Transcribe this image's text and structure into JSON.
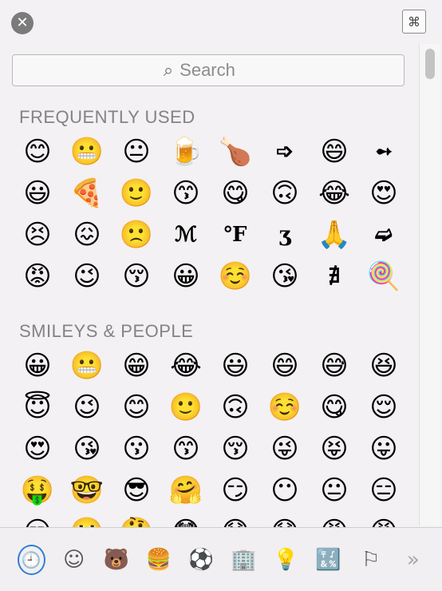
{
  "header": {
    "close_icon": "close-icon",
    "close_glyph": "✕",
    "grid_icon": "character-viewer-icon",
    "grid_glyph": "⌘"
  },
  "search": {
    "placeholder": "Search",
    "icon": "search-icon",
    "icon_glyph": "⌕"
  },
  "sections": [
    {
      "title": "FREQUENTLY USED",
      "items": [
        {
          "name": "smiling-face-with-smiling-eyes",
          "glyph": "😊"
        },
        {
          "name": "grimacing-face",
          "glyph": "😬"
        },
        {
          "name": "neutral-face",
          "glyph": "😐"
        },
        {
          "name": "beer-mug",
          "glyph": "🍺"
        },
        {
          "name": "poultry-leg",
          "glyph": "🍗"
        },
        {
          "name": "white-right-arrow",
          "glyph": "➩",
          "sym": true
        },
        {
          "name": "grinning-face-with-smiling-eyes",
          "glyph": "😄"
        },
        {
          "name": "feathered-arrow",
          "glyph": "➻",
          "sym": true
        },
        {
          "name": "smiley",
          "glyph": "😃"
        },
        {
          "name": "pizza",
          "glyph": "🍕"
        },
        {
          "name": "slightly-smiling-face",
          "glyph": "🙂"
        },
        {
          "name": "kissing-face-with-smiling-eyes",
          "glyph": "😙"
        },
        {
          "name": "face-savoring-food",
          "glyph": "😋"
        },
        {
          "name": "upside-down-face",
          "glyph": "🙃"
        },
        {
          "name": "face-with-tears-of-joy",
          "glyph": "😂"
        },
        {
          "name": "heart-eyes",
          "glyph": "😍"
        },
        {
          "name": "persevering-face",
          "glyph": "😣"
        },
        {
          "name": "confounded-face",
          "glyph": "😖"
        },
        {
          "name": "slightly-frowning-face",
          "glyph": "🙁"
        },
        {
          "name": "script-m",
          "glyph": "ℳ",
          "sym": true
        },
        {
          "name": "degree-fahrenheit",
          "glyph": "℉",
          "sym": true
        },
        {
          "name": "ezh",
          "glyph": "ʒ",
          "sym": true
        },
        {
          "name": "folded-hands",
          "glyph": "🙏"
        },
        {
          "name": "shadowed-arrow",
          "glyph": "➫",
          "sym": true
        },
        {
          "name": "pouting-face",
          "glyph": "😡"
        },
        {
          "name": "winking-face",
          "glyph": "😉"
        },
        {
          "name": "kissing-face-with-closed-eyes",
          "glyph": "😚"
        },
        {
          "name": "grinning-face",
          "glyph": "😀"
        },
        {
          "name": "smiling-face",
          "glyph": "☺️"
        },
        {
          "name": "face-blowing-a-kiss",
          "glyph": "😘"
        },
        {
          "name": "not-exists",
          "glyph": "∄",
          "sym": true
        },
        {
          "name": "lollipop",
          "glyph": "🍭"
        }
      ]
    },
    {
      "title": "SMILEYS & PEOPLE",
      "items": [
        {
          "name": "grinning-face",
          "glyph": "😀"
        },
        {
          "name": "grimacing-face",
          "glyph": "😬"
        },
        {
          "name": "beaming-face",
          "glyph": "😁"
        },
        {
          "name": "face-with-tears-of-joy",
          "glyph": "😂"
        },
        {
          "name": "smiley",
          "glyph": "😃"
        },
        {
          "name": "grinning-face-with-smiling-eyes",
          "glyph": "😄"
        },
        {
          "name": "grinning-face-with-sweat",
          "glyph": "😅"
        },
        {
          "name": "grinning-squinting-face",
          "glyph": "😆"
        },
        {
          "name": "smiling-face-with-halo",
          "glyph": "😇"
        },
        {
          "name": "winking-face",
          "glyph": "😉"
        },
        {
          "name": "smiling-face-with-smiling-eyes",
          "glyph": "😊"
        },
        {
          "name": "slightly-smiling-face",
          "glyph": "🙂"
        },
        {
          "name": "upside-down-face",
          "glyph": "🙃"
        },
        {
          "name": "smiling-face",
          "glyph": "☺️"
        },
        {
          "name": "face-savoring-food",
          "glyph": "😋"
        },
        {
          "name": "relieved-face",
          "glyph": "😌"
        },
        {
          "name": "heart-eyes",
          "glyph": "😍"
        },
        {
          "name": "face-blowing-a-kiss",
          "glyph": "😘"
        },
        {
          "name": "kissing-face",
          "glyph": "😗"
        },
        {
          "name": "kissing-face-with-smiling-eyes",
          "glyph": "😙"
        },
        {
          "name": "kissing-face-with-closed-eyes",
          "glyph": "😚"
        },
        {
          "name": "winking-face-with-tongue",
          "glyph": "😜"
        },
        {
          "name": "squinting-face-with-tongue",
          "glyph": "😝"
        },
        {
          "name": "face-with-tongue",
          "glyph": "😛"
        },
        {
          "name": "money-mouth-face",
          "glyph": "🤑"
        },
        {
          "name": "nerd-face",
          "glyph": "🤓"
        },
        {
          "name": "smiling-face-with-sunglasses",
          "glyph": "😎"
        },
        {
          "name": "hugging-face",
          "glyph": "🤗"
        },
        {
          "name": "smirking-face",
          "glyph": "😏"
        },
        {
          "name": "face-without-mouth",
          "glyph": "😶"
        },
        {
          "name": "neutral-face",
          "glyph": "😐"
        },
        {
          "name": "expressionless-face",
          "glyph": "😑"
        },
        {
          "name": "unamused-face",
          "glyph": "😒"
        },
        {
          "name": "face-with-rolling-eyes",
          "glyph": "🙄"
        },
        {
          "name": "thinking-face",
          "glyph": "🤔"
        },
        {
          "name": "flushed-face",
          "glyph": "😳"
        },
        {
          "name": "disappointed-face",
          "glyph": "😞"
        },
        {
          "name": "worried-face",
          "glyph": "😟"
        },
        {
          "name": "angry-face",
          "glyph": "😠"
        },
        {
          "name": "pouting-face",
          "glyph": "😡"
        }
      ]
    }
  ],
  "categories": [
    {
      "name": "recent-icon",
      "glyph": "🕘",
      "active": true
    },
    {
      "name": "smileys-icon",
      "glyph": "☺"
    },
    {
      "name": "animals-icon",
      "glyph": "🐻"
    },
    {
      "name": "food-icon",
      "glyph": "🍔"
    },
    {
      "name": "activity-icon",
      "glyph": "⚽"
    },
    {
      "name": "travel-icon",
      "glyph": "🏢"
    },
    {
      "name": "objects-icon",
      "glyph": "💡"
    },
    {
      "name": "symbols-icon",
      "glyph": "🔣"
    },
    {
      "name": "flags-icon",
      "glyph": "⚐"
    }
  ],
  "more_glyph": "»",
  "accent_color": "#2f7ed8"
}
